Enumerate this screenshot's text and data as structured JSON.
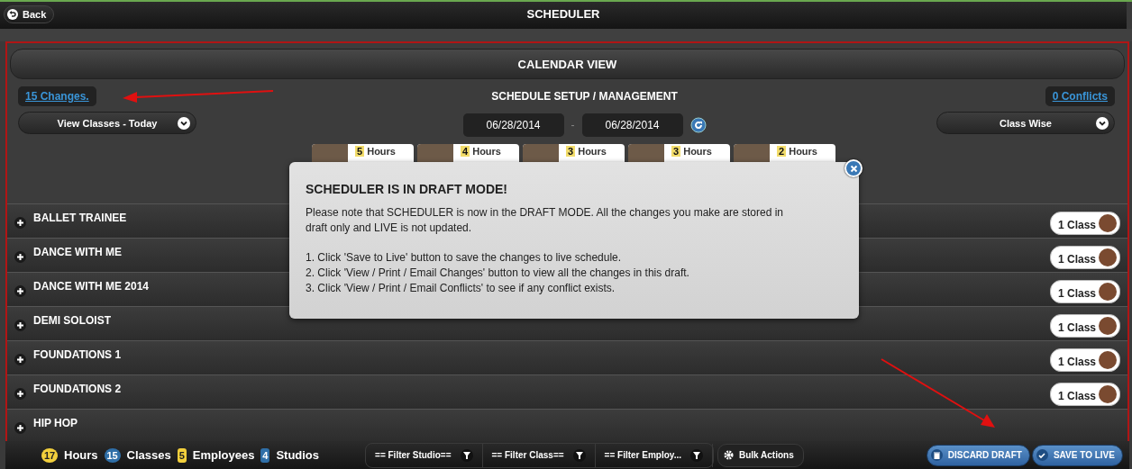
{
  "top_bar": {
    "back": "Back",
    "title": "SCHEDULER"
  },
  "calendar_view": {
    "title": "CALENDAR VIEW"
  },
  "setup": {
    "changes_link": "15 Changes.",
    "title": "SCHEDULE SETUP / MANAGEMENT",
    "conflicts_link": "0 Conflicts",
    "view_select": "View Classes - Today",
    "date_from": "06/28/2014",
    "date_separator": "-",
    "date_to": "06/28/2014",
    "mode_select": "Class Wise"
  },
  "employees": [
    {
      "hours": "5",
      "unit": "Hours"
    },
    {
      "hours": "4",
      "unit": "Hours"
    },
    {
      "hours": "3",
      "unit": "Hours"
    },
    {
      "hours": "3",
      "unit": "Hours"
    },
    {
      "hours": "2",
      "unit": "Hours"
    }
  ],
  "classes": [
    {
      "name": "BALLET TRAINEE",
      "count": "1 Class",
      "expanded": false
    },
    {
      "name": "DANCE WITH ME",
      "count": "1 Class",
      "expanded": false
    },
    {
      "name": "DANCE WITH ME 2014",
      "count": "1 Class",
      "expanded": false
    },
    {
      "name": "DEMI SOLOIST",
      "count": "1 Class",
      "expanded": false
    },
    {
      "name": "FOUNDATIONS 1",
      "count": "1 Class",
      "expanded": false
    },
    {
      "name": "FOUNDATIONS 2",
      "count": "1 Class",
      "expanded": false
    },
    {
      "name": "HIP HOP",
      "expanded": false
    }
  ],
  "modal": {
    "title": "SCHEDULER IS IN DRAFT MODE!",
    "paragraphs": [
      "Please note that SCHEDULER is now in the DRAFT MODE. All the changes you make are stored in draft only and LIVE is not updated."
    ],
    "steps": [
      "1. Click 'Save to Live' button to save the changes to live schedule.",
      "2. Click 'View / Print / Email Changes' button to view all the changes in this draft.",
      "3. Click 'View / Print / Email Conflicts' to see if any conflict exists."
    ]
  },
  "status_bar": {
    "stats": [
      {
        "count": "17",
        "label": "Hours",
        "kind": "circle",
        "color": "#f2cf3c"
      },
      {
        "count": "15",
        "label": "Classes",
        "kind": "circle",
        "color": "#2f6fa8"
      },
      {
        "count": "5",
        "label": "Employees",
        "kind": "square",
        "color": "#f2cf3c"
      },
      {
        "count": "4",
        "label": "Studios",
        "kind": "square",
        "color": "#2f6fa8"
      }
    ],
    "filters": [
      "== Filter Studio==",
      "== Filter Class==",
      "== Filter Employ..."
    ],
    "bulk_actions": "Bulk Actions",
    "discard": "DISCARD DRAFT",
    "save": "SAVE TO LIVE"
  }
}
